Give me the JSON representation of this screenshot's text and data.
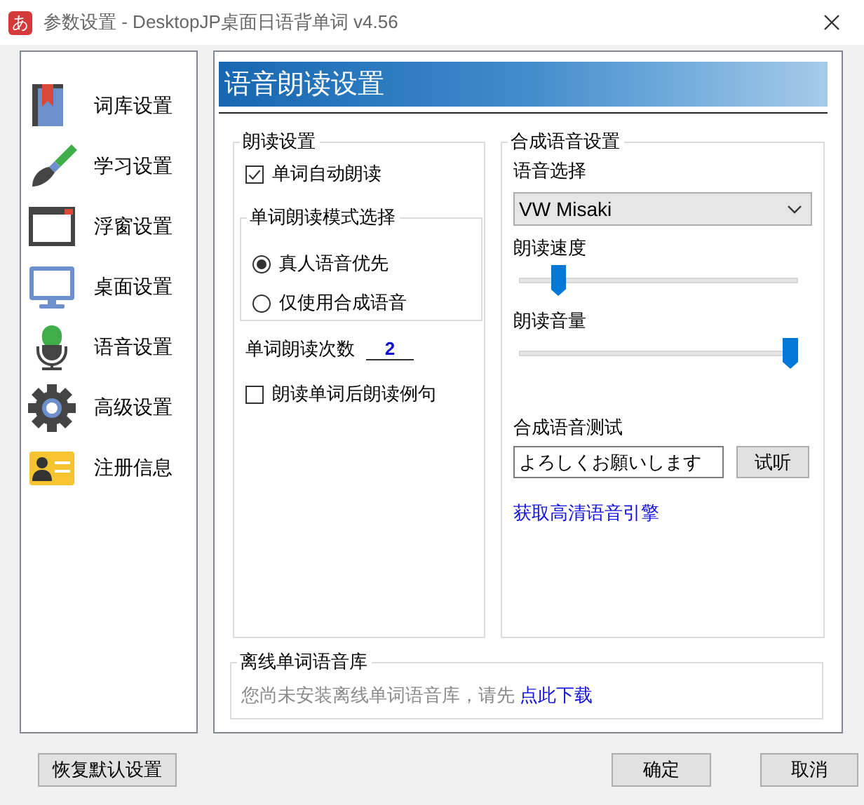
{
  "window": {
    "title": "参数设置 - DesktopJP桌面日语背单词 v4.56",
    "app_icon": "あ"
  },
  "sidebar": {
    "items": [
      {
        "label": "词库设置",
        "kind": "book"
      },
      {
        "label": "学习设置",
        "kind": "brush"
      },
      {
        "label": "浮窗设置",
        "kind": "window"
      },
      {
        "label": "桌面设置",
        "kind": "monitor"
      },
      {
        "label": "语音设置",
        "kind": "microphone"
      },
      {
        "label": "高级设置",
        "kind": "gear"
      },
      {
        "label": "注册信息",
        "kind": "card"
      }
    ]
  },
  "panel": {
    "title": "语音朗读设置"
  },
  "reading_group": {
    "legend": "朗读设置",
    "auto_read": {
      "label": "单词自动朗读",
      "checked": true
    },
    "mode_group": {
      "legend": "单词朗读模式选择",
      "options": [
        {
          "label": "真人语音优先",
          "selected": true
        },
        {
          "label": "仅使用合成语音",
          "selected": false
        }
      ]
    },
    "repeat": {
      "label": "单词朗读次数",
      "value": "2"
    },
    "read_example": {
      "label": "朗读单词后朗读例句",
      "checked": false
    }
  },
  "synth_group": {
    "legend": "合成语音设置",
    "voice": {
      "label": "语音选择",
      "value": "VW Misaki"
    },
    "sliders": [
      {
        "label": "朗读速度",
        "level": 0.12
      },
      {
        "label": "朗读音量",
        "level": 1.0
      }
    ],
    "test": {
      "label": "合成语音测试",
      "value": "よろしくお願いします",
      "button": "试听"
    },
    "link": "获取高清语音引擎"
  },
  "offline_group": {
    "legend": "离线单词语音库",
    "text": "您尚未安装离线单词语音库，请先",
    "link": "点此下载"
  },
  "buttons": {
    "reset": "恢复默认设置",
    "ok": "确定",
    "cancel": "取消"
  }
}
